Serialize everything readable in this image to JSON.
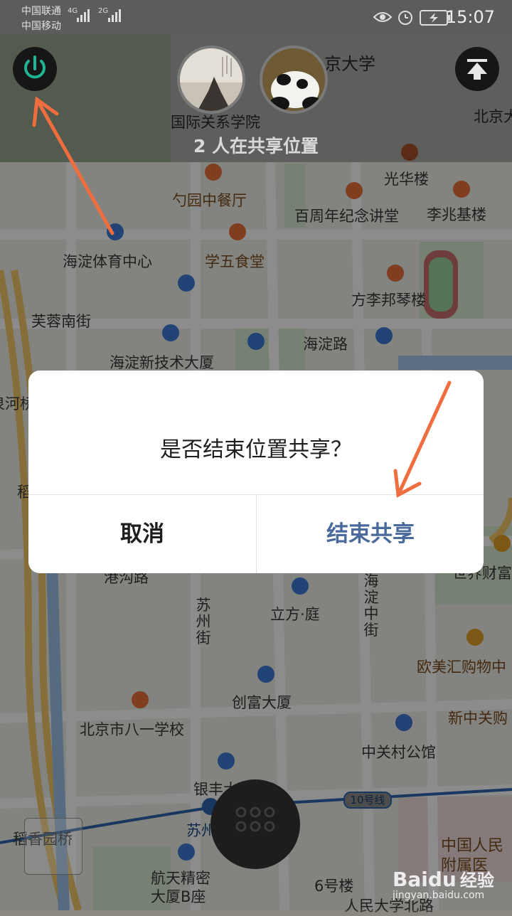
{
  "status_bar": {
    "carrier_1": "中国联通",
    "carrier_2": "中国移动",
    "net_1": "4G",
    "net_2": "2G",
    "time": "15:07"
  },
  "share_header": {
    "count_text": "2 人在共享位置"
  },
  "map": {
    "labels": {
      "jing_daxue": "京大学",
      "guoji": "国际关系学院",
      "beijing_da": "北京大",
      "guanghua": "光华楼",
      "shaoyuan": "勺园中餐厅",
      "baizhounian": "百周年纪念讲堂",
      "lizhaoji": "李兆基楼",
      "haidian_tiyu": "海淀体育中心",
      "xuewu": "学五食堂",
      "fanglibang": "方李邦琴楼",
      "furong": "芙蓉南街",
      "haidian_lu": "海淀路",
      "haidian_xinjishu": "海淀新技术大厦",
      "quan_he": "泉河桥",
      "dao": "稻",
      "gangou": "港沟路",
      "lifang": "立方·庭",
      "suzhou_jie": "苏州街",
      "haidian_zhongjie": "海淀中街",
      "shijie_caifu": "世界财富",
      "oumei": "欧美汇购物中",
      "chuangfu": "创富大厦",
      "bayi": "北京市八一学校",
      "xinzhongguan": "新中关购",
      "zhongguancun_park": "中关村公馆",
      "yinfeng": "银丰大厦",
      "suzhou_jie_station": "苏州街",
      "line10": "10号线",
      "daoxiang": "稻香园桥",
      "hangtian": "航天精密大厦B座",
      "no6": "6号楼",
      "renmin_hospital": "中国人民附属医",
      "renmin_road": "人民大学北路"
    }
  },
  "dialog": {
    "message": "是否结束位置共享？",
    "cancel_label": "取消",
    "confirm_label": "结束共享"
  },
  "watermark": {
    "brand": "Baidu",
    "product": "经验",
    "url": "jingyan.baidu.com"
  },
  "colors": {
    "arrow": "#ef6d3f",
    "power_icon": "#1fb594",
    "confirm_text": "#4a6a9c",
    "dialog_bg": "#ffffff"
  },
  "icons": [
    "power-icon",
    "move-to-top-icon",
    "menu-grid-icon",
    "layers-icon"
  ]
}
